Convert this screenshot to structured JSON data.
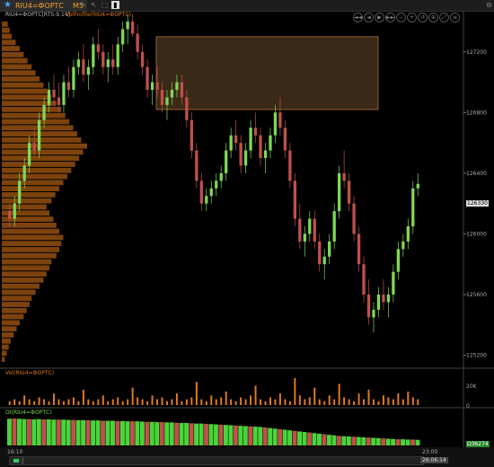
{
  "window": {
    "symbol": "RIU4=ФОРТС",
    "timeframe": "M5",
    "toolbar_icons": [
      "pencil-icon",
      "cursor-icon",
      "select-icon",
      "chart-icon"
    ]
  },
  "nav_buttons": [
    "◄◄",
    "◄",
    "▶",
    "►►",
    "−",
    "+",
    "↺",
    "⊕",
    "⤢",
    "≡"
  ],
  "price_panel": {
    "label": "RIU4=ФОРТС[RTS-9.14]",
    "volprofile_label": "VolProfile(RIU4=ФОРТС)",
    "y_ticks": [
      "127200",
      "126800",
      "126400",
      "126000",
      "125600",
      "125200"
    ],
    "y_values": [
      127200,
      126800,
      126400,
      126000,
      125600,
      125200
    ],
    "last_price": "126330"
  },
  "vol_panel": {
    "label": "Vol(RIU4=ФОРТС)",
    "ticks": [
      "20K",
      "0"
    ]
  },
  "oi_panel": {
    "label": "OI(RIU4=ФОРТС)",
    "last_value": "Ω36274"
  },
  "x_axis": {
    "left_time": "16:10",
    "right_time": "23:00",
    "date": "26.06.14"
  },
  "colors": {
    "up": "#7ed957",
    "down": "#c0504d",
    "profile": "#8b4a0e",
    "volume": "#e07a1a",
    "box": "#6a4a2a"
  },
  "chart_data": {
    "type": "candlestick",
    "ylim": [
      125150,
      127400
    ],
    "highlight_zone": [
      126820,
      127300
    ],
    "candles": [
      [
        126150,
        126200,
        126050,
        126100
      ],
      [
        126100,
        126250,
        126050,
        126200
      ],
      [
        126200,
        126400,
        126150,
        126350
      ],
      [
        126350,
        126500,
        126300,
        126450
      ],
      [
        126450,
        126650,
        126400,
        126600
      ],
      [
        126600,
        126700,
        126500,
        126550
      ],
      [
        126550,
        126800,
        126500,
        126750
      ],
      [
        126750,
        126900,
        126700,
        126850
      ],
      [
        126850,
        127000,
        126800,
        126950
      ],
      [
        126950,
        127050,
        126850,
        126900
      ],
      [
        126900,
        127000,
        126800,
        126850
      ],
      [
        126850,
        127050,
        126800,
        127000
      ],
      [
        127000,
        127100,
        126900,
        126950
      ],
      [
        126950,
        127150,
        126900,
        127100
      ],
      [
        127100,
        127200,
        127050,
        127150
      ],
      [
        127150,
        127250,
        127000,
        127050
      ],
      [
        127050,
        127150,
        126950,
        127100
      ],
      [
        127100,
        127300,
        127050,
        127250
      ],
      [
        127250,
        127350,
        127150,
        127200
      ],
      [
        127200,
        127250,
        127050,
        127100
      ],
      [
        127100,
        127200,
        127000,
        127150
      ],
      [
        127150,
        127250,
        127050,
        127100
      ],
      [
        127100,
        127300,
        127050,
        127250
      ],
      [
        127250,
        127400,
        127200,
        127350
      ],
      [
        127350,
        127450,
        127250,
        127400
      ],
      [
        127400,
        127450,
        127300,
        127320
      ],
      [
        127320,
        127380,
        127150,
        127200
      ],
      [
        127200,
        127250,
        127050,
        127100
      ],
      [
        127100,
        127150,
        126900,
        126950
      ],
      [
        126950,
        127050,
        126850,
        127000
      ],
      [
        127000,
        127100,
        126900,
        126950
      ],
      [
        126950,
        127000,
        126800,
        126850
      ],
      [
        126850,
        126950,
        126750,
        126900
      ],
      [
        126900,
        127000,
        126850,
        126950
      ],
      [
        126950,
        127050,
        126900,
        127000
      ],
      [
        127000,
        127050,
        126850,
        126900
      ],
      [
        126900,
        126950,
        126700,
        126750
      ],
      [
        126750,
        126800,
        126500,
        126550
      ],
      [
        126550,
        126600,
        126300,
        126350
      ],
      [
        126350,
        126400,
        126150,
        126200
      ],
      [
        126200,
        126300,
        126150,
        126250
      ],
      [
        126250,
        126350,
        126200,
        126300
      ],
      [
        126300,
        126400,
        126250,
        126350
      ],
      [
        126350,
        126450,
        126300,
        126400
      ],
      [
        126400,
        126600,
        126350,
        126550
      ],
      [
        126550,
        126700,
        126500,
        126650
      ],
      [
        126650,
        126750,
        126550,
        126600
      ],
      [
        126600,
        126650,
        126400,
        126450
      ],
      [
        126450,
        126600,
        126400,
        126550
      ],
      [
        126550,
        126750,
        126500,
        126700
      ],
      [
        126700,
        126800,
        126600,
        126650
      ],
      [
        126650,
        126700,
        126450,
        126500
      ],
      [
        126500,
        126600,
        126400,
        126550
      ],
      [
        126550,
        126700,
        126500,
        126650
      ],
      [
        126650,
        126850,
        126600,
        126800
      ],
      [
        126800,
        126900,
        126650,
        126700
      ],
      [
        126700,
        126750,
        126500,
        126550
      ],
      [
        126550,
        126600,
        126300,
        126350
      ],
      [
        126350,
        126400,
        126050,
        126100
      ],
      [
        126100,
        126200,
        125900,
        125950
      ],
      [
        125950,
        126050,
        125850,
        126000
      ],
      [
        126000,
        126150,
        125950,
        126100
      ],
      [
        126100,
        126150,
        125900,
        125950
      ],
      [
        125950,
        126000,
        125750,
        125800
      ],
      [
        125800,
        125900,
        125700,
        125850
      ],
      [
        125850,
        126000,
        125800,
        125950
      ],
      [
        125950,
        126200,
        125900,
        126150
      ],
      [
        126150,
        126450,
        126100,
        126400
      ],
      [
        126400,
        126550,
        126300,
        126350
      ],
      [
        126350,
        126400,
        126150,
        126200
      ],
      [
        126200,
        126250,
        125950,
        126000
      ],
      [
        126000,
        126050,
        125750,
        125800
      ],
      [
        125800,
        125850,
        125550,
        125600
      ],
      [
        125600,
        125700,
        125400,
        125450
      ],
      [
        125450,
        125550,
        125350,
        125500
      ],
      [
        125500,
        125650,
        125450,
        125600
      ],
      [
        125600,
        125700,
        125500,
        125550
      ],
      [
        125550,
        125650,
        125450,
        125600
      ],
      [
        125600,
        125800,
        125550,
        125750
      ],
      [
        125750,
        125950,
        125700,
        125900
      ],
      [
        125900,
        126000,
        125850,
        125950
      ],
      [
        125950,
        126100,
        125900,
        126050
      ],
      [
        126050,
        126350,
        126000,
        126300
      ],
      [
        126300,
        126400,
        126250,
        126330
      ]
    ],
    "volume_profile": [
      3,
      5,
      7,
      9,
      12,
      15,
      18,
      22,
      25,
      28,
      30,
      34,
      38,
      42,
      45,
      48,
      50,
      55,
      58,
      60,
      62,
      58,
      55,
      52,
      48,
      45,
      50,
      54,
      58,
      62,
      66,
      70,
      74,
      78,
      82,
      86,
      80,
      76,
      72,
      68,
      64,
      60,
      55,
      50,
      46,
      42,
      38,
      34,
      30,
      26,
      22,
      18,
      14,
      10,
      8,
      6
    ],
    "volumes": [
      2,
      3,
      2,
      5,
      3,
      2,
      4,
      3,
      2,
      6,
      3,
      2,
      3,
      4,
      2,
      8,
      3,
      2,
      3,
      5,
      2,
      3,
      4,
      2,
      3,
      9,
      4,
      3,
      2,
      5,
      3,
      4,
      2,
      3,
      6,
      2,
      3,
      4,
      12,
      3,
      2,
      5,
      3,
      4,
      7,
      3,
      2,
      4,
      3,
      5,
      10,
      3,
      2,
      4,
      3,
      6,
      3,
      2,
      14,
      5,
      3,
      4,
      9,
      3,
      2,
      5,
      3,
      11,
      4,
      3,
      2,
      6,
      3,
      8,
      3,
      2,
      5,
      4,
      3,
      6,
      3,
      7,
      4,
      3
    ],
    "oi": [
      95,
      96,
      95,
      94,
      94,
      93,
      94,
      93,
      93,
      92,
      92,
      92,
      91,
      91,
      90,
      90,
      90,
      89,
      89,
      88,
      88,
      88,
      87,
      87,
      86,
      86,
      86,
      85,
      84,
      84,
      83,
      83,
      82,
      82,
      81,
      80,
      80,
      79,
      78,
      78,
      77,
      76,
      75,
      74,
      73,
      72,
      71,
      70,
      69,
      68,
      67,
      66,
      64,
      62,
      60,
      58,
      56,
      54,
      52,
      50,
      48,
      46,
      44,
      42,
      40,
      38,
      36,
      34,
      33,
      32,
      31,
      30,
      29,
      28,
      27,
      26,
      25,
      24,
      23,
      22,
      22,
      21,
      21,
      20
    ]
  }
}
